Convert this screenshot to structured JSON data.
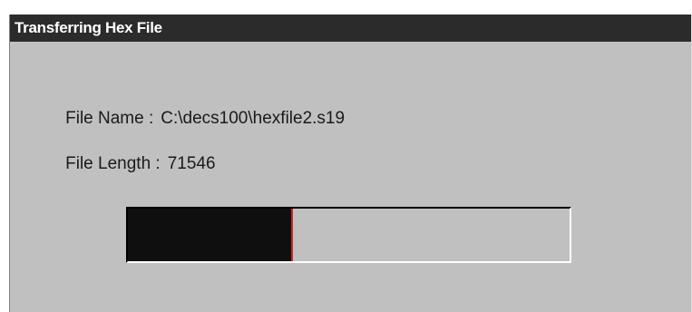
{
  "dialog": {
    "title": "Transferring Hex File",
    "file_name_label": "File Name :",
    "file_name_value": "C:\\decs100\\hexfile2.s19",
    "file_length_label": "File Length :",
    "file_length_value": "71546"
  },
  "progress": {
    "fraction": 0.37,
    "fill_color": "#0f0f0f",
    "track_color": "#c0c0c0"
  },
  "colors": {
    "titlebar": "#2b2b2b",
    "dialog_bg": "#c0c0c0"
  }
}
